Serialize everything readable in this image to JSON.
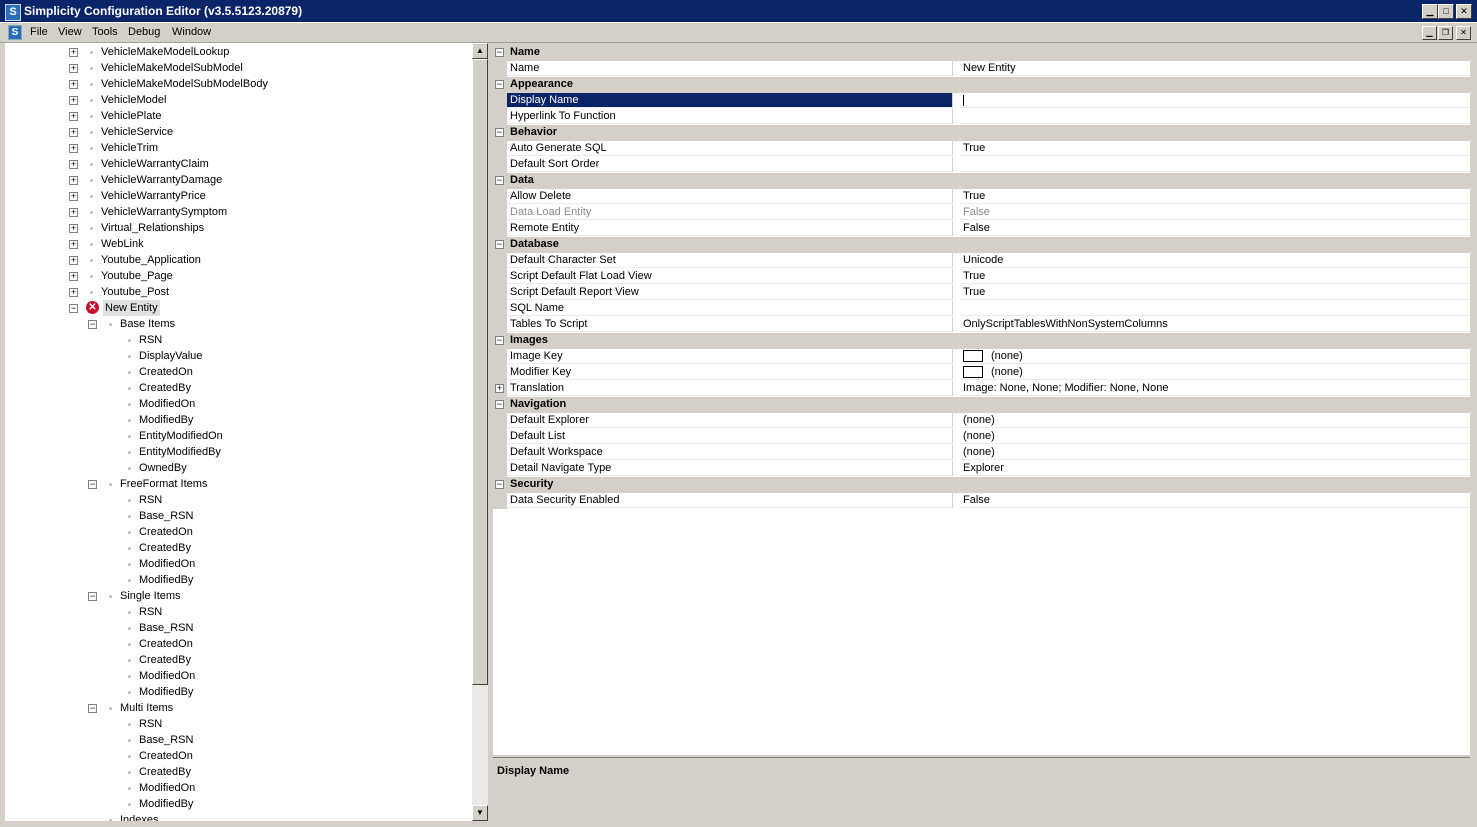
{
  "window": {
    "title": "Simplicity Configuration Editor (v3.5.5123.20879)",
    "app_icon": "S",
    "controls": [
      "minimize-icon",
      "maximize-icon",
      "close-icon"
    ]
  },
  "menu": {
    "items": [
      "File",
      "View",
      "Tools",
      "Debug",
      "Window"
    ]
  },
  "tree": {
    "items": [
      {
        "label": "VehicleMakeModelLookup",
        "level": 1,
        "toggle": "+"
      },
      {
        "label": "VehicleMakeModelSubModel",
        "level": 1,
        "toggle": "+"
      },
      {
        "label": "VehicleMakeModelSubModelBody",
        "level": 1,
        "toggle": "+"
      },
      {
        "label": "VehicleModel",
        "level": 1,
        "toggle": "+"
      },
      {
        "label": "VehiclePlate",
        "level": 1,
        "toggle": "+"
      },
      {
        "label": "VehicleService",
        "level": 1,
        "toggle": "+"
      },
      {
        "label": "VehicleTrim",
        "level": 1,
        "toggle": "+"
      },
      {
        "label": "VehicleWarrantyClaim",
        "level": 1,
        "toggle": "+"
      },
      {
        "label": "VehicleWarrantyDamage",
        "level": 1,
        "toggle": "+"
      },
      {
        "label": "VehicleWarrantyPrice",
        "level": 1,
        "toggle": "+"
      },
      {
        "label": "VehicleWarrantySymptom",
        "level": 1,
        "toggle": "+"
      },
      {
        "label": "Virtual_Relationships",
        "level": 1,
        "toggle": "+"
      },
      {
        "label": "WebLink",
        "level": 1,
        "toggle": "+"
      },
      {
        "label": "Youtube_Application",
        "level": 1,
        "toggle": "+"
      },
      {
        "label": "Youtube_Page",
        "level": 1,
        "toggle": "+"
      },
      {
        "label": "Youtube_Post",
        "level": 1,
        "toggle": "+"
      },
      {
        "label": "New Entity",
        "level": 1,
        "toggle": "−",
        "error": true,
        "selected": true
      },
      {
        "label": "Base Items",
        "level": 2,
        "toggle": "−"
      },
      {
        "label": "RSN",
        "level": 3
      },
      {
        "label": "DisplayValue",
        "level": 3
      },
      {
        "label": "CreatedOn",
        "level": 3
      },
      {
        "label": "CreatedBy",
        "level": 3
      },
      {
        "label": "ModifiedOn",
        "level": 3
      },
      {
        "label": "ModifiedBy",
        "level": 3
      },
      {
        "label": "EntityModifiedOn",
        "level": 3
      },
      {
        "label": "EntityModifiedBy",
        "level": 3
      },
      {
        "label": "OwnedBy",
        "level": 3
      },
      {
        "label": "FreeFormat Items",
        "level": 2,
        "toggle": "−"
      },
      {
        "label": "RSN",
        "level": 3
      },
      {
        "label": "Base_RSN",
        "level": 3
      },
      {
        "label": "CreatedOn",
        "level": 3
      },
      {
        "label": "CreatedBy",
        "level": 3
      },
      {
        "label": "ModifiedOn",
        "level": 3
      },
      {
        "label": "ModifiedBy",
        "level": 3
      },
      {
        "label": "Single Items",
        "level": 2,
        "toggle": "−"
      },
      {
        "label": "RSN",
        "level": 3
      },
      {
        "label": "Base_RSN",
        "level": 3
      },
      {
        "label": "CreatedOn",
        "level": 3
      },
      {
        "label": "CreatedBy",
        "level": 3
      },
      {
        "label": "ModifiedOn",
        "level": 3
      },
      {
        "label": "ModifiedBy",
        "level": 3
      },
      {
        "label": "Multi Items",
        "level": 2,
        "toggle": "−"
      },
      {
        "label": "RSN",
        "level": 3
      },
      {
        "label": "Base_RSN",
        "level": 3
      },
      {
        "label": "CreatedOn",
        "level": 3
      },
      {
        "label": "CreatedBy",
        "level": 3
      },
      {
        "label": "ModifiedOn",
        "level": 3
      },
      {
        "label": "ModifiedBy",
        "level": 3
      },
      {
        "label": "Indexes",
        "level": 2
      }
    ]
  },
  "properties": {
    "rows": [
      {
        "kind": "cat",
        "label": "Name"
      },
      {
        "kind": "prop",
        "name": "Name",
        "value": "New Entity"
      },
      {
        "kind": "cat",
        "label": "Appearance"
      },
      {
        "kind": "prop",
        "name": "Display Name",
        "value": "",
        "selected": true
      },
      {
        "kind": "prop",
        "name": "Hyperlink To Function",
        "value": ""
      },
      {
        "kind": "cat",
        "label": "Behavior"
      },
      {
        "kind": "prop",
        "name": "Auto Generate SQL",
        "value": "True"
      },
      {
        "kind": "prop",
        "name": "Default Sort Order",
        "value": ""
      },
      {
        "kind": "cat",
        "label": "Data"
      },
      {
        "kind": "prop",
        "name": "Allow Delete",
        "value": "True"
      },
      {
        "kind": "prop",
        "name": "Data Load Entity",
        "value": "False",
        "disabled": true
      },
      {
        "kind": "prop",
        "name": "Remote Entity",
        "value": "False"
      },
      {
        "kind": "cat",
        "label": "Database"
      },
      {
        "kind": "prop",
        "name": "Default Character Set",
        "value": "Unicode"
      },
      {
        "kind": "prop",
        "name": "Script Default Flat Load View",
        "value": "True"
      },
      {
        "kind": "prop",
        "name": "Script Default Report View",
        "value": "True"
      },
      {
        "kind": "prop",
        "name": "SQL Name",
        "value": ""
      },
      {
        "kind": "prop",
        "name": "Tables To Script",
        "value": "OnlyScriptTablesWithNonSystemColumns"
      },
      {
        "kind": "cat",
        "label": "Images"
      },
      {
        "kind": "prop",
        "name": "Image Key",
        "value": "(none)",
        "swatch": true
      },
      {
        "kind": "prop",
        "name": "Modifier Key",
        "value": "(none)",
        "swatch": true
      },
      {
        "kind": "prop",
        "name": "Translation",
        "value": "Image: None, None; Modifier: None, None",
        "expand": true
      },
      {
        "kind": "cat",
        "label": "Navigation"
      },
      {
        "kind": "prop",
        "name": "Default Explorer",
        "value": "(none)"
      },
      {
        "kind": "prop",
        "name": "Default List",
        "value": "(none)"
      },
      {
        "kind": "prop",
        "name": "Default Workspace",
        "value": "(none)"
      },
      {
        "kind": "prop",
        "name": "Detail Navigate Type",
        "value": "Explorer"
      },
      {
        "kind": "cat",
        "label": "Security"
      },
      {
        "kind": "prop",
        "name": "Data Security Enabled",
        "value": "False"
      }
    ]
  },
  "description": {
    "title": "Display Name"
  },
  "colors": {
    "title_bar": "#0a246a",
    "selection": "#0a246a",
    "error": "#c8102e"
  }
}
